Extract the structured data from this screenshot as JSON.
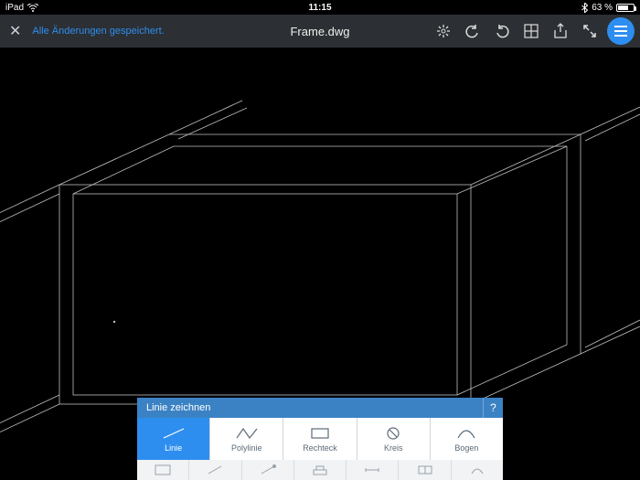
{
  "status": {
    "device": "iPad",
    "time": "11:15",
    "battery_pct": "63 %"
  },
  "appbar": {
    "save_status": "Alle Änderungen gespeichert.",
    "title": "Frame.dwg"
  },
  "toolbar": {
    "header": "Linie zeichnen",
    "help": "?",
    "items": [
      {
        "label": "Linie"
      },
      {
        "label": "Polylinie"
      },
      {
        "label": "Rechteck"
      },
      {
        "label": "Kreis"
      },
      {
        "label": "Bogen"
      }
    ],
    "active_index": 0
  }
}
